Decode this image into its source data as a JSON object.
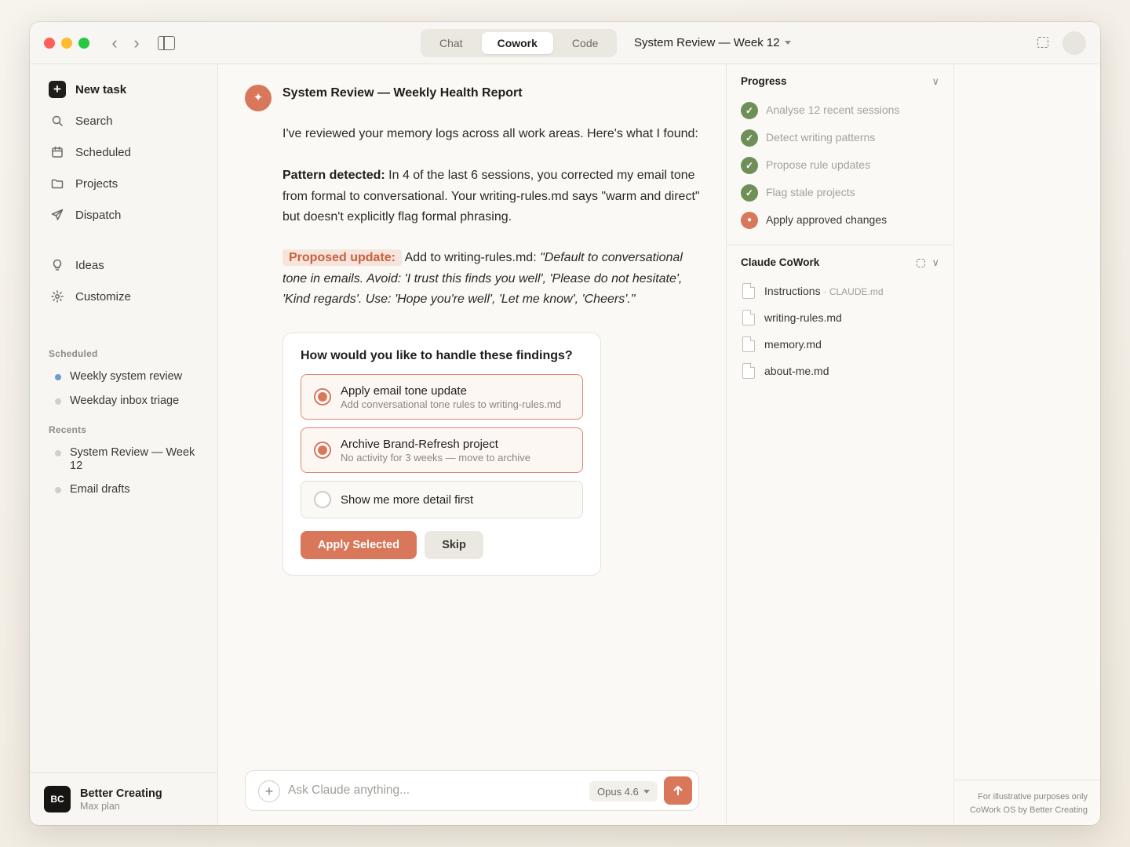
{
  "titlebar": {
    "tabs": [
      {
        "label": "Chat"
      },
      {
        "label": "Cowork"
      },
      {
        "label": "Code"
      }
    ],
    "active_tab": "Cowork",
    "document_title": "System Review — Week 12"
  },
  "sidebar": {
    "primary": [
      {
        "label": "New task",
        "icon": "plus-icon"
      },
      {
        "label": "Search",
        "icon": "search-icon"
      },
      {
        "label": "Scheduled",
        "icon": "calendar-icon"
      },
      {
        "label": "Projects",
        "icon": "folder-icon"
      },
      {
        "label": "Dispatch",
        "icon": "send-icon"
      }
    ],
    "secondary": [
      {
        "label": "Ideas",
        "icon": "lightbulb-icon"
      },
      {
        "label": "Customize",
        "icon": "gear-icon"
      }
    ],
    "scheduled_label": "Scheduled",
    "scheduled": [
      {
        "label": "Weekly system review",
        "status_color": "#6e9ccb"
      },
      {
        "label": "Weekday inbox triage",
        "status_color": "#d2cfc8"
      }
    ],
    "recents_label": "Recents",
    "recents": [
      {
        "label": "System Review — Week 12"
      },
      {
        "label": "Email drafts"
      }
    ],
    "account": {
      "initials": "BC",
      "name": "Better Creating",
      "plan": "Max plan"
    }
  },
  "message": {
    "avatar_glyph": "✦",
    "title": "System Review — Weekly Health Report",
    "intro": "I've reviewed your memory logs across all work areas. Here's what I found:",
    "pattern_label": "Pattern detected:",
    "pattern_text": " In 4 of the last 6 sessions, you corrected my email tone from formal to conversational. Your writing-rules.md says \"warm and direct\" but doesn't explicitly flag formal phrasing.",
    "proposal_label": "Proposed update:",
    "proposal_prefix": " Add to writing-rules.md: ",
    "proposal_quote": "\"Default to conversational tone in emails. Avoid: 'I trust this finds you well', 'Please do not hesitate', 'Kind regards'. Use: 'Hope you're well', 'Let me know', 'Cheers'.\""
  },
  "question_card": {
    "question": "How would you like to handle these findings?",
    "options": [
      {
        "title": "Apply email tone update",
        "subtitle": "Add conversational tone rules to writing-rules.md",
        "selected": true
      },
      {
        "title": "Archive Brand-Refresh project",
        "subtitle": "No activity for 3 weeks — move to archive",
        "selected": true
      },
      {
        "title": "Show me more detail first",
        "subtitle": "",
        "selected": false
      }
    ],
    "apply_label": "Apply Selected",
    "skip_label": "Skip"
  },
  "composer": {
    "placeholder": "Ask Claude anything...",
    "model": "Opus 4.6"
  },
  "progress": {
    "title": "Progress",
    "steps": [
      {
        "label": "Analyse 12 recent sessions",
        "status": "done"
      },
      {
        "label": "Detect writing patterns",
        "status": "done"
      },
      {
        "label": "Propose rule updates",
        "status": "done"
      },
      {
        "label": "Flag stale projects",
        "status": "done"
      },
      {
        "label": "Apply approved changes",
        "status": "in-progress"
      }
    ]
  },
  "files_panel": {
    "title": "Claude CoWork",
    "files": [
      {
        "name": "Instructions",
        "meta": "· CLAUDE.md"
      },
      {
        "name": "writing-rules.md",
        "meta": ""
      },
      {
        "name": "memory.md",
        "meta": ""
      },
      {
        "name": "about-me.md",
        "meta": ""
      }
    ]
  },
  "footer_note": {
    "line1": "For illustrative purposes only",
    "line2": "CoWork OS by Better Creating"
  },
  "colors": {
    "accent": "#d9775a",
    "done_green": "#6f8f58",
    "scheduled_blue": "#6e9ccb"
  }
}
